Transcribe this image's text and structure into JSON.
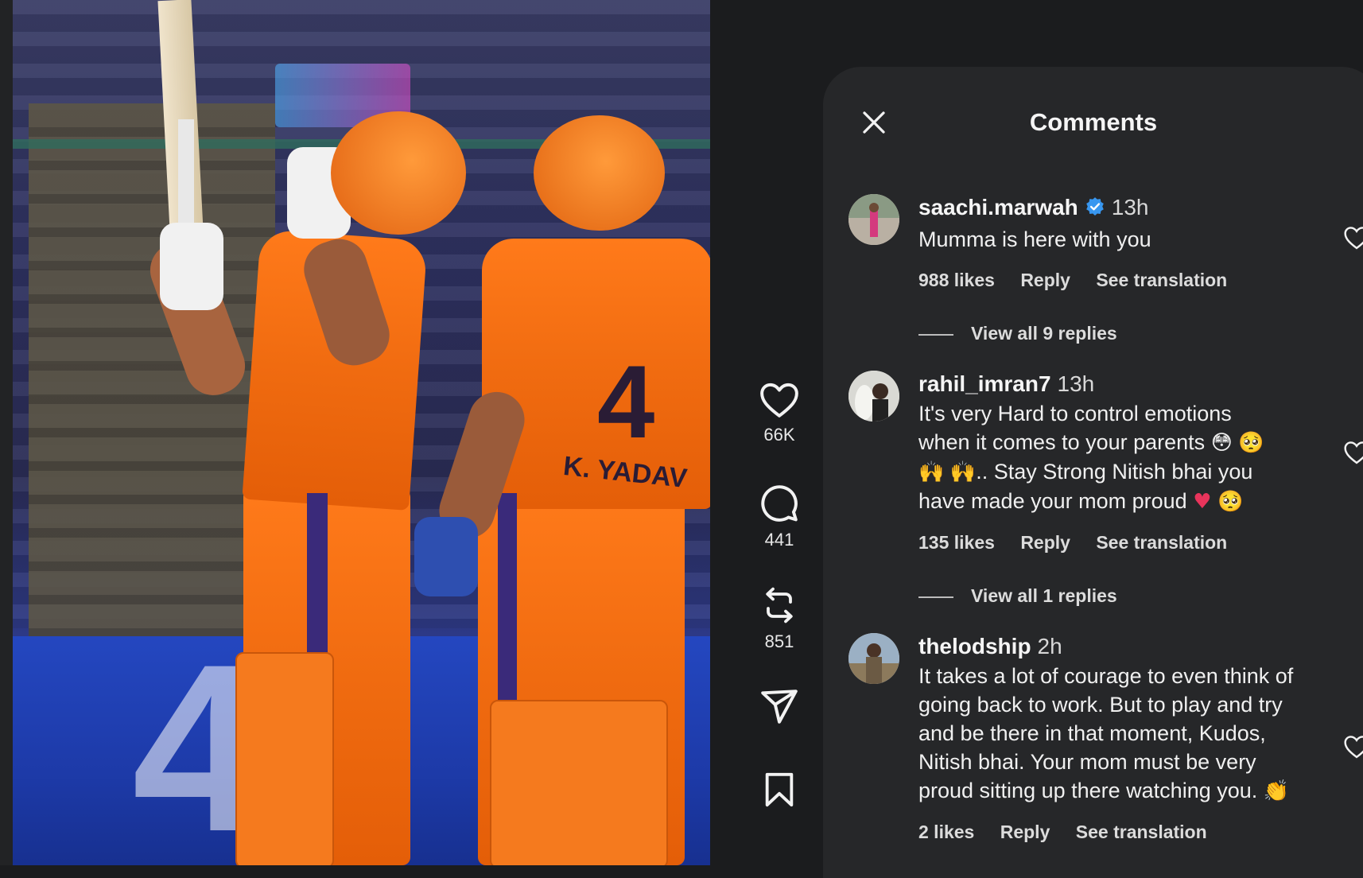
{
  "panel": {
    "title": "Comments"
  },
  "actions": {
    "likes": "66K",
    "comments": "441",
    "reposts": "851"
  },
  "comments": [
    {
      "username": "saachi.marwah",
      "verified": true,
      "time": "13h",
      "text": "Mumma is here with you",
      "likes": "988 likes",
      "reply": "Reply",
      "translate": "See translation",
      "replies": "View all 9 replies"
    },
    {
      "username": "rahil_imran7",
      "verified": false,
      "time": "13h",
      "text_line1": "It's very Hard to control emotions",
      "text_line2": "when it comes to your parents",
      "text_line3": ".. Stay Strong Nitish bhai you",
      "text_line4": "have made your mom proud",
      "likes": "135 likes",
      "reply": "Reply",
      "translate": "See translation",
      "replies": "View all 1 replies"
    },
    {
      "username": "thelodship",
      "verified": false,
      "time": "2h",
      "text": "It takes a lot of courage to even think of going back to work. But to play and try and be there in that moment, Kudos, Nitish bhai. Your mom must be very proud sitting up there watching you.",
      "likes": "2 likes",
      "reply": "Reply",
      "translate": "See translation"
    }
  ],
  "media": {
    "jersey_number": "4",
    "jersey_name": "K. YADAV",
    "board_text": "4"
  }
}
